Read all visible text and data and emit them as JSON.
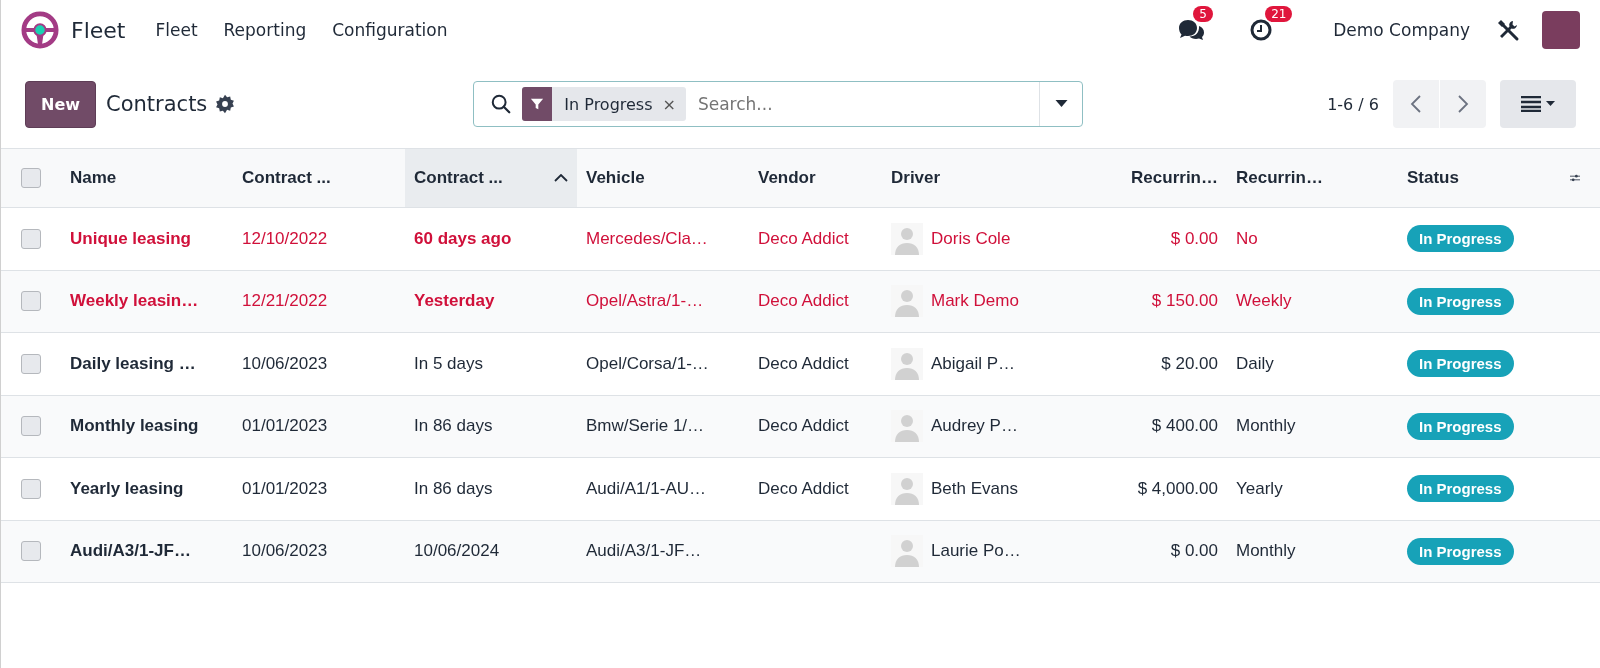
{
  "navbar": {
    "app_name": "Fleet",
    "menu": [
      "Fleet",
      "Reporting",
      "Configuration"
    ],
    "messages_count": "5",
    "activities_count": "21",
    "company": "Demo Company"
  },
  "control_panel": {
    "new_button": "New",
    "title": "Contracts",
    "facet": "In Progress",
    "facet_remove": "×",
    "placeholder": "Search...",
    "pager": "1-6 / 6"
  },
  "table": {
    "select_all": {
      "checked": false
    },
    "columns": [
      {
        "label": "Name",
        "sorted": false
      },
      {
        "label": "Contract ...",
        "sorted": false
      },
      {
        "label": "Contract ...",
        "sorted": true
      },
      {
        "label": "Vehicle",
        "sorted": false
      },
      {
        "label": "Vendor",
        "sorted": false
      },
      {
        "label": "Driver",
        "sorted": false
      },
      {
        "label": "Recurrin…",
        "sorted": false
      },
      {
        "label": "Recurrin…",
        "sorted": false
      },
      {
        "label": "Status",
        "sorted": false
      }
    ],
    "rows": [
      {
        "checked": false,
        "overdue": true,
        "name": "Unique leasing",
        "start": "12/10/2022",
        "end": "60 days ago",
        "vehicle": "Mercedes/Cla…",
        "vendor": "Deco Addict",
        "driver": "Doris Cole",
        "amount": "$ 0.00",
        "frequency": "No",
        "status": "In Progress"
      },
      {
        "checked": false,
        "overdue": true,
        "name": "Weekly leasin…",
        "start": "12/21/2022",
        "end": "Yesterday",
        "vehicle": "Opel/Astra/1-…",
        "vendor": "Deco Addict",
        "driver": "Mark Demo",
        "amount": "$ 150.00",
        "frequency": "Weekly",
        "status": "In Progress"
      },
      {
        "checked": false,
        "overdue": false,
        "name": "Daily leasing …",
        "start": "10/06/2023",
        "end": "In 5 days",
        "vehicle": "Opel/Corsa/1-…",
        "vendor": "Deco Addict",
        "driver": "Abigail P…",
        "amount": "$ 20.00",
        "frequency": "Daily",
        "status": "In Progress"
      },
      {
        "checked": false,
        "overdue": false,
        "name": "Monthly leasing",
        "start": "01/01/2023",
        "end": "In 86 days",
        "vehicle": "Bmw/Serie 1/…",
        "vendor": "Deco Addict",
        "driver": "Audrey P…",
        "amount": "$ 400.00",
        "frequency": "Monthly",
        "status": "In Progress"
      },
      {
        "checked": false,
        "overdue": false,
        "name": "Yearly leasing",
        "start": "01/01/2023",
        "end": "In 86 days",
        "vehicle": "Audi/A1/1-AU…",
        "vendor": "Deco Addict",
        "driver": "Beth Evans",
        "amount": "$ 4,000.00",
        "frequency": "Yearly",
        "status": "In Progress"
      },
      {
        "checked": false,
        "overdue": false,
        "name": "Audi/A3/1-JF…",
        "start": "10/06/2023",
        "end": "10/06/2024",
        "vehicle": "Audi/A3/1-JF…",
        "driver": "Laurie Po…",
        "amount": "$ 0.00",
        "frequency": "Monthly",
        "status": "In Progress"
      }
    ]
  }
}
